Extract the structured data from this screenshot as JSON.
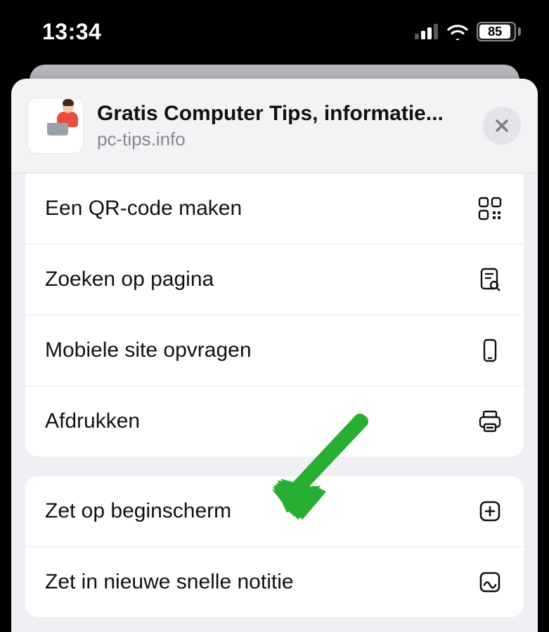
{
  "status": {
    "time": "13:34",
    "battery_percent": "85"
  },
  "header": {
    "title": "Gratis Computer Tips, informatie...",
    "subtitle": "pc-tips.info"
  },
  "groups": [
    {
      "rows": [
        {
          "label": "Een QR-code maken",
          "icon": "qr-code-icon"
        },
        {
          "label": "Zoeken op pagina",
          "icon": "find-on-page-icon"
        },
        {
          "label": "Mobiele site opvragen",
          "icon": "mobile-site-icon"
        },
        {
          "label": "Afdrukken",
          "icon": "printer-icon"
        }
      ]
    },
    {
      "rows": [
        {
          "label": "Zet op beginscherm",
          "icon": "add-to-home-icon"
        },
        {
          "label": "Zet in nieuwe snelle notitie",
          "icon": "quick-note-icon"
        }
      ]
    }
  ],
  "annotation": {
    "arrow_color": "#27ae33"
  }
}
